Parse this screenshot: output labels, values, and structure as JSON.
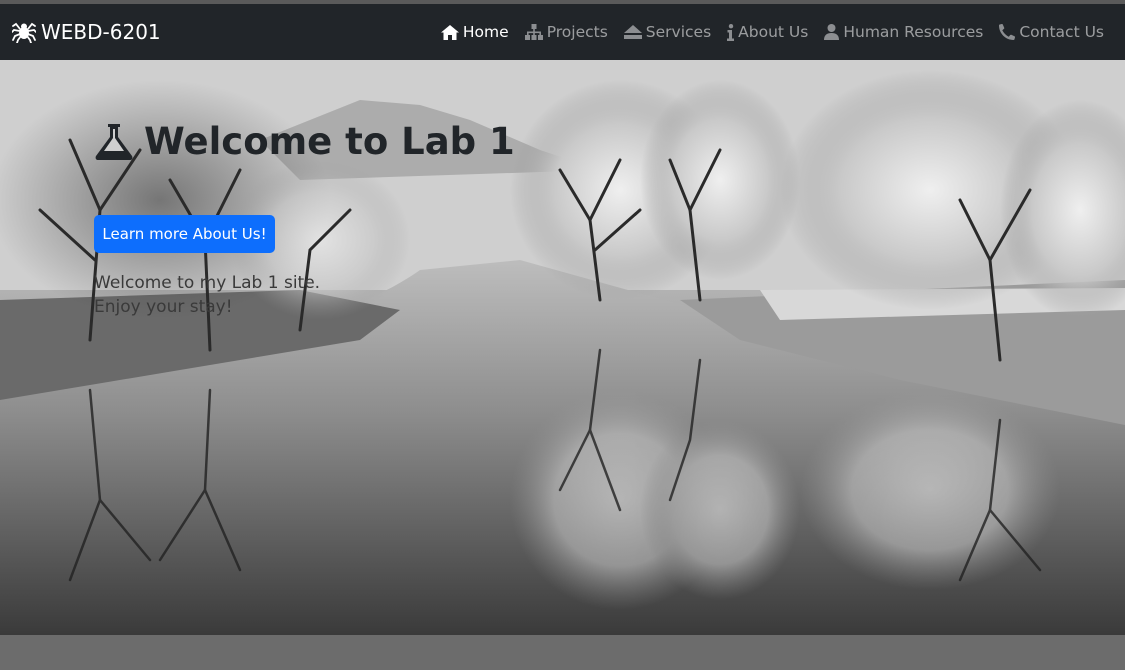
{
  "brand": {
    "name": "WEBD-6201",
    "icon": "spider-icon"
  },
  "nav": {
    "items": [
      {
        "label": "Home",
        "icon": "home-icon",
        "active": true
      },
      {
        "label": "Projects",
        "icon": "sitemap-icon",
        "active": false
      },
      {
        "label": "Services",
        "icon": "eject-icon",
        "active": false
      },
      {
        "label": "About Us",
        "icon": "info-icon",
        "active": false
      },
      {
        "label": "Human Resources",
        "icon": "user-icon",
        "active": false
      },
      {
        "label": "Contact Us",
        "icon": "phone-icon",
        "active": false
      }
    ]
  },
  "hero": {
    "title": "Welcome to Lab 1",
    "title_icon": "flask-icon",
    "button_label": "Learn more About Us!",
    "line1": "Welcome to my Lab 1 site.",
    "line2": "Enjoy your stay!"
  },
  "colors": {
    "navbar": "#212529",
    "accent": "#0d6efd",
    "page_background": "#6c6c6c"
  }
}
